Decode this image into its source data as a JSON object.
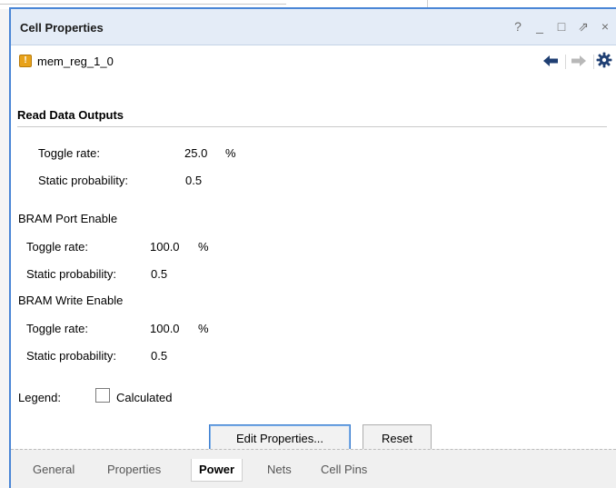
{
  "panel": {
    "title": "Cell Properties",
    "controls": [
      "?",
      "_",
      "□",
      "⇗",
      "×"
    ]
  },
  "object": {
    "name": "mem_reg_1_0",
    "icon_glyph": "!"
  },
  "read_data_outputs": {
    "heading": "Read Data Outputs",
    "toggle_label": "Toggle rate:",
    "toggle_value": "25.0",
    "toggle_unit": "%",
    "static_label": "Static probability:",
    "static_value": "0.5"
  },
  "bram_port_enable": {
    "heading": "BRAM Port Enable",
    "toggle_label": "Toggle rate:",
    "toggle_value": "100.0",
    "toggle_unit": "%",
    "static_label": "Static probability:",
    "static_value": "0.5"
  },
  "bram_write_enable": {
    "heading": "BRAM Write Enable",
    "toggle_label": "Toggle rate:",
    "toggle_value": "100.0",
    "toggle_unit": "%",
    "static_label": "Static probability:",
    "static_value": "0.5"
  },
  "legend": {
    "label": "Legend:",
    "item": "Calculated"
  },
  "buttons": {
    "edit": "Edit Properties...",
    "reset": "Reset"
  },
  "tabs": [
    "General",
    "Properties",
    "Power",
    "Nets",
    "Cell Pins"
  ],
  "active_tab": "Power",
  "colors": {
    "accent": "#4a86d6",
    "header_bg": "#e4ecf7",
    "cell_icon": "#e8a21a"
  }
}
